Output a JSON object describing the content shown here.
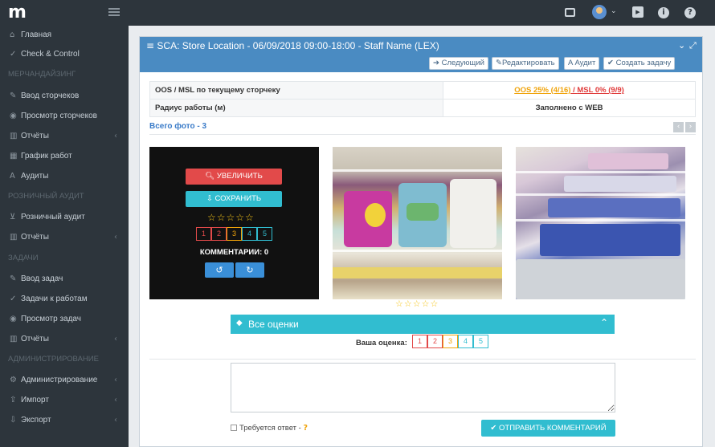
{
  "app": {
    "logo_text": "m"
  },
  "topbar": {
    "icons": [
      "window-icon",
      "user-avatar-icon",
      "youtube-icon",
      "info-icon",
      "help-icon"
    ],
    "avatar_caret": "⌄"
  },
  "sidebar": {
    "items": [
      {
        "label": "Главная",
        "icon": "home-icon"
      },
      {
        "label": "Check & Control",
        "icon": "check-icon"
      }
    ],
    "sections": [
      {
        "header": "МЕРЧАНДАЙЗИНГ",
        "items": [
          {
            "label": "Ввод сторчеков",
            "icon": "edit-icon"
          },
          {
            "label": "Просмотр сторчеков",
            "icon": "eye-icon"
          },
          {
            "label": "Отчёты",
            "icon": "bar-chart-icon",
            "expandable": true
          },
          {
            "label": "График работ",
            "icon": "calendar-icon"
          },
          {
            "label": "Аудиты",
            "icon": "font-icon"
          }
        ]
      },
      {
        "header": "РОЗНИЧНЫЙ АУДИТ",
        "items": [
          {
            "label": "Розничный аудит",
            "icon": "cart-icon"
          },
          {
            "label": "Отчёты",
            "icon": "bar-chart-icon",
            "expandable": true
          }
        ]
      },
      {
        "header": "ЗАДАЧИ",
        "items": [
          {
            "label": "Ввод задач",
            "icon": "edit-icon"
          },
          {
            "label": "Задачи к работам",
            "icon": "check-icon"
          },
          {
            "label": "Просмотр задач",
            "icon": "eye-icon"
          },
          {
            "label": "Отчёты",
            "icon": "bar-chart-icon",
            "expandable": true
          }
        ]
      },
      {
        "header": "АДМИНИСТРИРОВАНИЕ",
        "items": [
          {
            "label": "Администрирование",
            "icon": "cogs-icon",
            "expandable": true
          },
          {
            "label": "Импорт",
            "icon": "upload-icon",
            "expandable": true
          },
          {
            "label": "Экспорт",
            "icon": "download-icon",
            "expandable": true
          }
        ]
      }
    ]
  },
  "panel": {
    "title": "SCA: Store Location - 06/09/2018 09:00-18:00 - Staff Name (LEX)",
    "toolbar": {
      "next": "Следующий",
      "edit": "Редактировать",
      "audit": "Аудит",
      "create_task": "Создать задачу"
    },
    "info_rows": [
      {
        "label": "OOS / MSL по текущему сторчеку",
        "oos": "OOS 25% (4/16)",
        "sep": " / ",
        "msl": "MSL 0% (9/9)"
      },
      {
        "label": "Радиус работы (м)",
        "value": "Заполнено с WEB"
      }
    ],
    "total_photos": "Всего фото - 3",
    "photo_overlay": {
      "zoom": "УВЕЛИЧИТЬ",
      "save": "СОХРАНИТЬ",
      "stars": "☆☆☆☆☆",
      "ratings": [
        "1",
        "2",
        "3",
        "4",
        "5"
      ],
      "comments": "КОММЕНТАРИИ: 0"
    },
    "photos": [
      {
        "alt": "photo-1"
      },
      {
        "alt": "photo-2"
      },
      {
        "alt": "photo-3"
      }
    ],
    "photo_stars": "☆☆☆☆☆",
    "all_ratings": {
      "title": "Все оценки",
      "your_rating_label": "Ваша оценка:",
      "ratings": [
        "1",
        "2",
        "3",
        "4",
        "5"
      ]
    },
    "comment": {
      "placeholder": "",
      "needs_reply_label": "Требуется ответ -",
      "send_label": "ОТПРАВИТЬ КОММЕНТАРИЙ"
    }
  },
  "colors": {
    "rating": [
      "#e24a4a",
      "#e24a4a",
      "#f0a30a",
      "#31bdd0",
      "#3a8fd8"
    ],
    "accent": "#31bdd0",
    "header": "#4a8bc2"
  }
}
